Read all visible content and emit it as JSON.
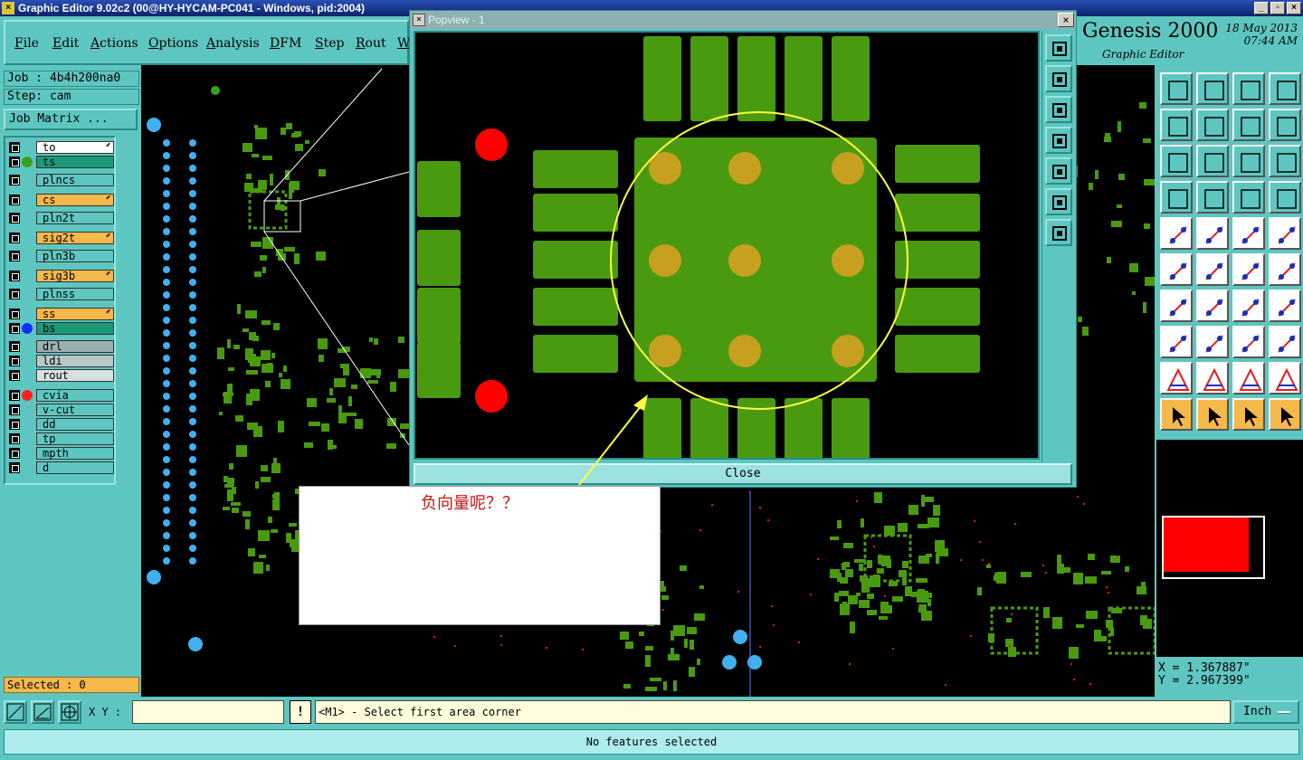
{
  "window": {
    "title": "Graphic Editor 9.02c2 (00@HY-HYCAM-PC041 - Windows, pid:2004)",
    "controls": [
      "_",
      "▫",
      "×"
    ]
  },
  "menu": [
    "File",
    "Edit",
    "Actions",
    "Options",
    "Analysis",
    "DFM",
    "Step",
    "Rout",
    "W"
  ],
  "branding": {
    "name": "Genesis 2000",
    "subtitle": "Graphic Editor",
    "date": "18 May 2013",
    "time": "07:44 AM"
  },
  "job": {
    "job_label": "Job : 4b4h200na0",
    "step_label": "Step: cam",
    "matrix_button": "Job Matrix ..."
  },
  "layers": [
    {
      "name": "to",
      "color": "#ffffff",
      "dot": "",
      "edit": true
    },
    {
      "name": "ts",
      "color": "#1a9a7a",
      "dot": "#3aa020",
      "edit": false
    },
    {
      "name": "plncs",
      "color": "#5ec6c0",
      "dot": "",
      "edit": false
    },
    {
      "name": "cs",
      "color": "#f5b84a",
      "dot": "",
      "edit": true
    },
    {
      "name": "pln2t",
      "color": "#5ec6c0",
      "dot": "",
      "edit": false
    },
    {
      "name": "sig2t",
      "color": "#f5b84a",
      "dot": "",
      "edit": true
    },
    {
      "name": "pln3b",
      "color": "#5ec6c0",
      "dot": "",
      "edit": false
    },
    {
      "name": "sig3b",
      "color": "#f5b84a",
      "dot": "",
      "edit": true
    },
    {
      "name": "plnss",
      "color": "#5ec6c0",
      "dot": "",
      "edit": false
    },
    {
      "name": "ss",
      "color": "#f5b84a",
      "dot": "",
      "edit": true
    },
    {
      "name": "bs",
      "color": "#1a9a7a",
      "dot": "#1030ff",
      "edit": false
    },
    {
      "name": "drl",
      "color": "#9ab0b0",
      "dot": "",
      "edit": false
    },
    {
      "name": "ldi",
      "color": "#b8c8c8",
      "dot": "",
      "edit": false
    },
    {
      "name": "rout",
      "color": "#d8e0e0",
      "dot": "",
      "edit": false
    },
    {
      "name": "cvia",
      "color": "#5ec6c0",
      "dot": "#ff2020",
      "edit": false
    },
    {
      "name": "v-cut",
      "color": "#5ec6c0",
      "dot": "",
      "edit": false
    },
    {
      "name": "dd",
      "color": "#5ec6c0",
      "dot": "",
      "edit": false
    },
    {
      "name": "tp",
      "color": "#5ec6c0",
      "dot": "",
      "edit": false
    },
    {
      "name": "mpth",
      "color": "#5ec6c0",
      "dot": "",
      "edit": false
    },
    {
      "name": "d",
      "color": "#5ec6c0",
      "dot": "",
      "edit": false
    }
  ],
  "selected": "Selected : 0",
  "popview": {
    "title": "Popview - 1",
    "close_glyph": "×",
    "close_label": "Close"
  },
  "annotation": "负向量呢？？",
  "coordinates": {
    "x": "X = 1.367887\"",
    "y": "Y = 2.967399\""
  },
  "bottom": {
    "xy_label": "X Y :",
    "xy_value": "",
    "excl": "!",
    "prompt": "<M1> - Select first area corner",
    "unit": "Inch",
    "status": "No features selected"
  },
  "colors": {
    "teal": "#5ec6c0",
    "pad_green": "#4a9a10",
    "drill_orange": "#c8a020",
    "via_blue": "#40b0f0",
    "via_red": "#ff0000",
    "highlight_yellow": "#ffff40"
  },
  "icons": {
    "tool_rows": [
      [
        "zoom-home-icon",
        "zoom-in-icon",
        "zoom-home-area-icon",
        "zoom-window-icon"
      ],
      [
        "pan-left-icon",
        "pan-right-icon",
        "redraw-icon",
        "sun-icon"
      ],
      [
        "fit-icon",
        "center-icon",
        "scale-1-2-icon",
        "help-icon"
      ],
      [
        "tools-icon",
        "grid-icon",
        "snap-icon",
        "snap-red-icon"
      ],
      [
        "measure-icon",
        "highlight-icon",
        "ruler-icon",
        "dot-icon"
      ],
      [
        "connect-icon",
        "cross-icon",
        "add-arrow-icon",
        "move-arrow-icon"
      ],
      [
        "angle-icon",
        "line-icon",
        "rotate-icon",
        "mirror-icon"
      ],
      [
        "copy-icon",
        "cut-icon",
        "resize-icon",
        "select-group-icon"
      ],
      [
        "triangle-icon",
        "triangle-a-icon",
        "triangle-b-icon",
        "triangle-c-icon"
      ],
      [
        "pointer-icon",
        "pointer-box-icon",
        "pointer-select-icon",
        "pointer-route-icon"
      ]
    ]
  }
}
